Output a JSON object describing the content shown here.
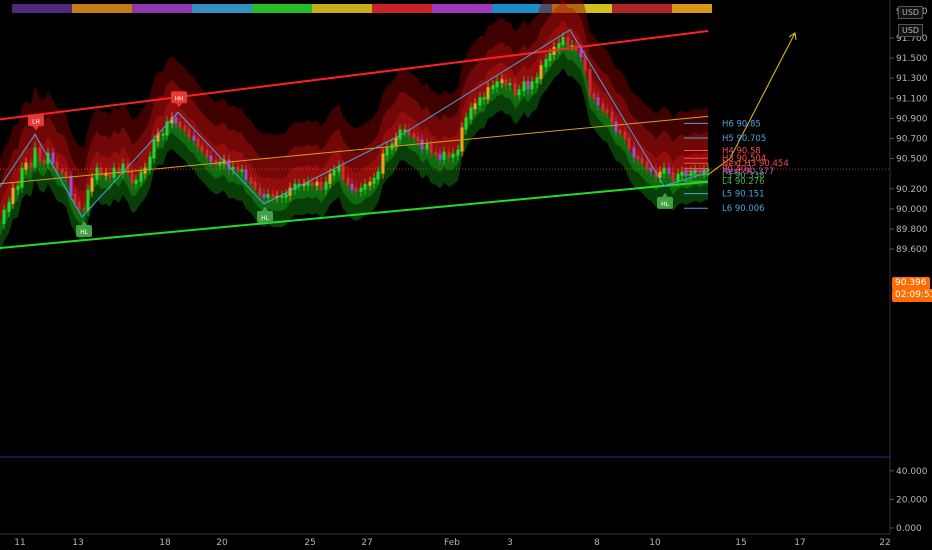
{
  "chart_data": {
    "type": "line",
    "instrument_currency": "USD",
    "last_price": "90.396",
    "countdown": "02:09:51",
    "price_axis": {
      "ticks": [
        "91.700",
        "91.500",
        "91.300",
        "91.100",
        "90.900",
        "90.700",
        "90.500",
        "90.200",
        "90.000",
        "89.800",
        "89.600"
      ],
      "tick_values": [
        91.7,
        91.5,
        91.3,
        91.1,
        90.9,
        90.7,
        90.5,
        90.2,
        90.0,
        89.8,
        89.6
      ],
      "partial_top_tick": "91.900",
      "ylim": [
        89.47,
        91.97
      ]
    },
    "oscillator_axis": {
      "ticks": [
        "40.000",
        "20.000",
        "0.000"
      ],
      "tick_values": [
        40,
        20,
        0
      ]
    },
    "x_ticks": [
      "11",
      "13",
      "18",
      "20",
      "25",
      "27",
      "Feb",
      "3",
      "8",
      "10",
      "15",
      "17",
      "22"
    ],
    "price_path": [
      [
        0,
        89.86
      ],
      [
        4,
        89.98
      ],
      [
        9,
        90.06
      ],
      [
        13,
        90.2
      ],
      [
        18,
        90.22
      ],
      [
        22,
        90.4
      ],
      [
        26,
        90.45
      ],
      [
        31,
        90.42
      ],
      [
        35,
        90.6
      ],
      [
        40,
        90.48
      ],
      [
        44,
        90.46
      ],
      [
        48,
        90.55
      ],
      [
        53,
        90.46
      ],
      [
        57,
        90.38
      ],
      [
        62,
        90.36
      ],
      [
        66,
        90.32
      ],
      [
        71,
        90.14
      ],
      [
        75,
        90.06
      ],
      [
        79,
        90.0
      ],
      [
        84,
        89.99
      ],
      [
        88,
        90.18
      ],
      [
        92,
        90.3
      ],
      [
        97,
        90.4
      ],
      [
        101,
        90.34
      ],
      [
        106,
        90.35
      ],
      [
        110,
        90.32
      ],
      [
        114,
        90.4
      ],
      [
        119,
        90.36
      ],
      [
        123,
        90.44
      ],
      [
        128,
        90.36
      ],
      [
        132,
        90.26
      ],
      [
        136,
        90.28
      ],
      [
        141,
        90.36
      ],
      [
        145,
        90.4
      ],
      [
        150,
        90.51
      ],
      [
        154,
        90.68
      ],
      [
        158,
        90.74
      ],
      [
        163,
        90.74
      ],
      [
        167,
        90.86
      ],
      [
        172,
        90.9
      ],
      [
        176,
        90.86
      ],
      [
        180,
        90.82
      ],
      [
        185,
        90.78
      ],
      [
        189,
        90.72
      ],
      [
        194,
        90.69
      ],
      [
        198,
        90.62
      ],
      [
        202,
        90.58
      ],
      [
        207,
        90.52
      ],
      [
        211,
        90.48
      ],
      [
        216,
        90.44
      ],
      [
        220,
        90.46
      ],
      [
        224,
        90.48
      ],
      [
        229,
        90.4
      ],
      [
        233,
        90.41
      ],
      [
        238,
        90.38
      ],
      [
        242,
        90.38
      ],
      [
        246,
        90.3
      ],
      [
        251,
        90.26
      ],
      [
        255,
        90.2
      ],
      [
        260,
        90.14
      ],
      [
        264,
        90.12
      ],
      [
        268,
        90.14
      ],
      [
        273,
        90.12
      ],
      [
        277,
        90.12
      ],
      [
        282,
        90.12
      ],
      [
        286,
        90.14
      ],
      [
        290,
        90.2
      ],
      [
        295,
        90.24
      ],
      [
        299,
        90.24
      ],
      [
        304,
        90.24
      ],
      [
        308,
        90.26
      ],
      [
        312,
        90.24
      ],
      [
        317,
        90.26
      ],
      [
        321,
        90.2
      ],
      [
        326,
        90.26
      ],
      [
        330,
        90.34
      ],
      [
        334,
        90.38
      ],
      [
        339,
        90.42
      ],
      [
        343,
        90.3
      ],
      [
        348,
        90.24
      ],
      [
        352,
        90.2
      ],
      [
        356,
        90.18
      ],
      [
        361,
        90.2
      ],
      [
        365,
        90.24
      ],
      [
        370,
        90.26
      ],
      [
        374,
        90.3
      ],
      [
        378,
        90.36
      ],
      [
        383,
        90.54
      ],
      [
        387,
        90.6
      ],
      [
        392,
        90.64
      ],
      [
        396,
        90.7
      ],
      [
        400,
        90.78
      ],
      [
        405,
        90.78
      ],
      [
        409,
        90.74
      ],
      [
        414,
        90.71
      ],
      [
        418,
        90.68
      ],
      [
        422,
        90.6
      ],
      [
        427,
        90.64
      ],
      [
        431,
        90.56
      ],
      [
        436,
        90.54
      ],
      [
        440,
        90.5
      ],
      [
        444,
        90.56
      ],
      [
        449,
        90.52
      ],
      [
        453,
        90.54
      ],
      [
        458,
        90.58
      ],
      [
        462,
        90.8
      ],
      [
        466,
        90.9
      ],
      [
        471,
        91.0
      ],
      [
        475,
        91.04
      ],
      [
        480,
        91.1
      ],
      [
        484,
        91.1
      ],
      [
        488,
        91.2
      ],
      [
        493,
        91.22
      ],
      [
        497,
        91.26
      ],
      [
        502,
        91.28
      ],
      [
        506,
        91.24
      ],
      [
        510,
        91.24
      ],
      [
        515,
        91.14
      ],
      [
        519,
        91.18
      ],
      [
        524,
        91.26
      ],
      [
        528,
        91.2
      ],
      [
        532,
        91.26
      ],
      [
        537,
        91.3
      ],
      [
        541,
        91.42
      ],
      [
        546,
        91.48
      ],
      [
        550,
        91.54
      ],
      [
        554,
        91.6
      ],
      [
        559,
        91.64
      ],
      [
        563,
        91.7
      ],
      [
        568,
        91.62
      ],
      [
        572,
        91.62
      ],
      [
        576,
        91.58
      ],
      [
        581,
        91.52
      ],
      [
        585,
        91.38
      ],
      [
        590,
        91.14
      ],
      [
        594,
        91.1
      ],
      [
        598,
        91.04
      ],
      [
        603,
        90.98
      ],
      [
        607,
        90.96
      ],
      [
        612,
        90.86
      ],
      [
        616,
        90.78
      ],
      [
        620,
        90.76
      ],
      [
        625,
        90.7
      ],
      [
        629,
        90.6
      ],
      [
        634,
        90.52
      ],
      [
        638,
        90.5
      ],
      [
        642,
        90.46
      ],
      [
        647,
        90.4
      ],
      [
        651,
        90.38
      ],
      [
        656,
        90.32
      ],
      [
        660,
        90.36
      ],
      [
        664,
        90.4
      ],
      [
        669,
        90.36
      ],
      [
        673,
        90.28
      ],
      [
        678,
        90.34
      ],
      [
        682,
        90.36
      ],
      [
        686,
        90.34
      ],
      [
        691,
        90.36
      ],
      [
        695,
        90.38
      ],
      [
        700,
        90.36
      ],
      [
        704,
        90.38
      ],
      [
        708,
        90.39
      ]
    ],
    "zigzag": [
      [
        0,
        90.22
      ],
      [
        35,
        90.74
      ],
      [
        82,
        89.92
      ],
      [
        178,
        90.96
      ],
      [
        264,
        90.05
      ],
      [
        402,
        90.74
      ],
      [
        570,
        91.78
      ],
      [
        664,
        90.23
      ],
      [
        708,
        90.36
      ]
    ],
    "zigzag_labels": [
      {
        "text": "LH",
        "x": 36,
        "price": 90.88,
        "type": "high"
      },
      {
        "text": "HL",
        "x": 84,
        "price": 89.78,
        "type": "low"
      },
      {
        "text": "HH",
        "x": 179,
        "price": 91.11,
        "type": "high"
      },
      {
        "text": "HL",
        "x": 265,
        "price": 89.92,
        "type": "low"
      },
      {
        "text": "HL",
        "x": 665,
        "price": 90.06,
        "type": "low"
      }
    ],
    "channel": {
      "upper": [
        [
          0,
          90.89
        ],
        [
          708,
          91.77
        ]
      ],
      "lower": [
        [
          0,
          89.61
        ],
        [
          708,
          90.27
        ]
      ],
      "middle": [
        [
          0,
          90.25
        ],
        [
          708,
          90.92
        ]
      ]
    },
    "projection": [
      [
        708,
        90.34
      ],
      [
        730,
        90.5
      ],
      [
        795,
        91.75
      ]
    ],
    "levels": [
      {
        "label": "H6 90.85",
        "price": 90.85,
        "color": "#4aa3df"
      },
      {
        "label": "H5 90.705",
        "price": 90.705,
        "color": "#4aa3df"
      },
      {
        "label": "H4 90.58",
        "price": 90.58,
        "color": "#ff4d4d"
      },
      {
        "label": "H3 90.504",
        "price": 90.504,
        "color": "#ff4d4d"
      },
      {
        "label": "Next H3 90.454",
        "price": 90.454,
        "color": "#ff4d4d"
      },
      {
        "label": "90.402",
        "price": 90.402,
        "color": "#ff4d4d"
      },
      {
        "label": "Next 90.377",
        "price": 90.377,
        "color": "#c050e0"
      },
      {
        "label": "L3 90.338",
        "price": 90.338,
        "color": "#4caf50"
      },
      {
        "label": "L4 90.276",
        "price": 90.276,
        "color": "#4caf50"
      },
      {
        "label": "L5 90.151",
        "price": 90.151,
        "color": "#4aa3df"
      },
      {
        "label": "L6 90.006",
        "price": 90.006,
        "color": "#4aa3df"
      }
    ],
    "colors": {
      "background": "#000000",
      "channel_upper": "#ff2020",
      "channel_lower": "#22dd22",
      "channel_middle": "#d4a020",
      "zigzag": "#4aa3df",
      "projection": "#e6c319",
      "cloud_bear": "#8b0000",
      "cloud_bull": "#0a5a0a",
      "badge_high": "#e53935",
      "badge_low": "#43a047",
      "last_price_badge": "#f7941d",
      "oscillator_divider": "#2a2e8a"
    }
  }
}
